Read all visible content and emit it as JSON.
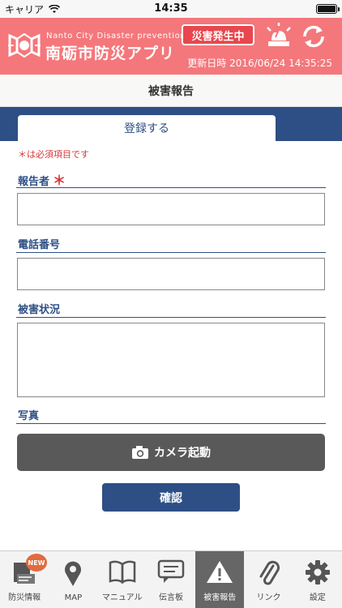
{
  "status_bar": {
    "carrier": "キャリア",
    "time": "14:35"
  },
  "header": {
    "app_subtitle": "Nanto City Disaster prevention app",
    "app_title": "南砺市防災アプリ",
    "disaster_badge": "災害発生中",
    "updated_label": "更新日時",
    "updated_value": "2016/06/24 14:35:25"
  },
  "page_title": "被害報告",
  "tab": {
    "label": "登録する"
  },
  "form": {
    "required_note": "＊は必須項目です",
    "required_mark": "＊",
    "reporter_label": "報告者",
    "reporter_value": "",
    "phone_label": "電話番号",
    "phone_value": "",
    "damage_label": "被害状況",
    "damage_value": "",
    "photo_label": "写真",
    "camera_button": "カメラ起動",
    "confirm_button": "確認"
  },
  "tabbar": {
    "new_badge": "NEW",
    "active_index": 4,
    "items": [
      {
        "label": "防災情報",
        "icon": "disaster-info-icon"
      },
      {
        "label": "MAP",
        "icon": "map-pin-icon"
      },
      {
        "label": "マニュアル",
        "icon": "manual-book-icon"
      },
      {
        "label": "伝言板",
        "icon": "message-board-icon"
      },
      {
        "label": "被害報告",
        "icon": "warning-icon"
      },
      {
        "label": "リンク",
        "icon": "paperclip-icon"
      },
      {
        "label": "設定",
        "icon": "gear-icon"
      }
    ]
  },
  "colors": {
    "header": "#f4777b",
    "primary": "#2e4f85",
    "badge": "#e8474e",
    "camera": "#595959",
    "required": "#d93535"
  }
}
